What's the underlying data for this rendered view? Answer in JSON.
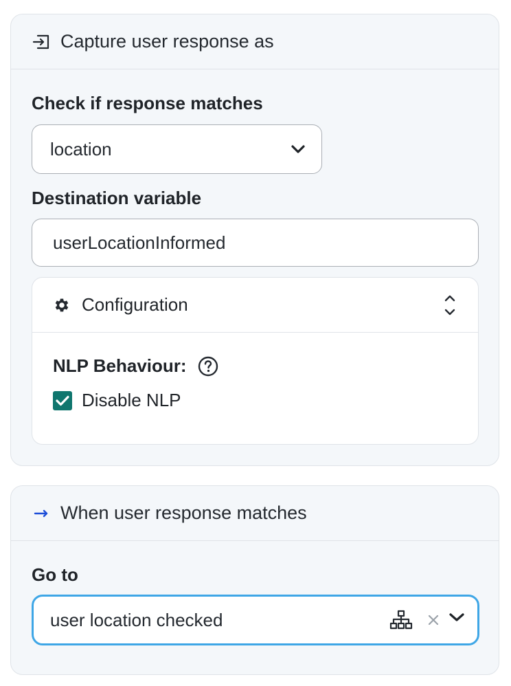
{
  "capture": {
    "header_title": "Capture user response as",
    "check_label": "Check if response matches",
    "match_select_value": "location",
    "destination_label": "Destination variable",
    "destination_value": "userLocationInformed",
    "configuration": {
      "title": "Configuration",
      "nlp_label": "NLP Behaviour:",
      "disable_nlp_label": "Disable NLP",
      "disable_nlp_checked": true
    }
  },
  "when_matches": {
    "header_title": "When user response matches",
    "goto_label": "Go to",
    "goto_value": "user location checked"
  },
  "colors": {
    "accent_teal": "#0f766e",
    "focus_blue": "#3ea6e6",
    "arrow_blue": "#1d4ed8",
    "card_bg": "#f4f7fa"
  },
  "icons": {
    "capture_header": "input-arrow-icon",
    "when_header": "arrow-right-icon",
    "config": "gear-icon",
    "help": "question-circle-icon",
    "goto_tree": "sitemap-icon",
    "clear": "close-icon",
    "chevron": "chevron-down-icon"
  }
}
